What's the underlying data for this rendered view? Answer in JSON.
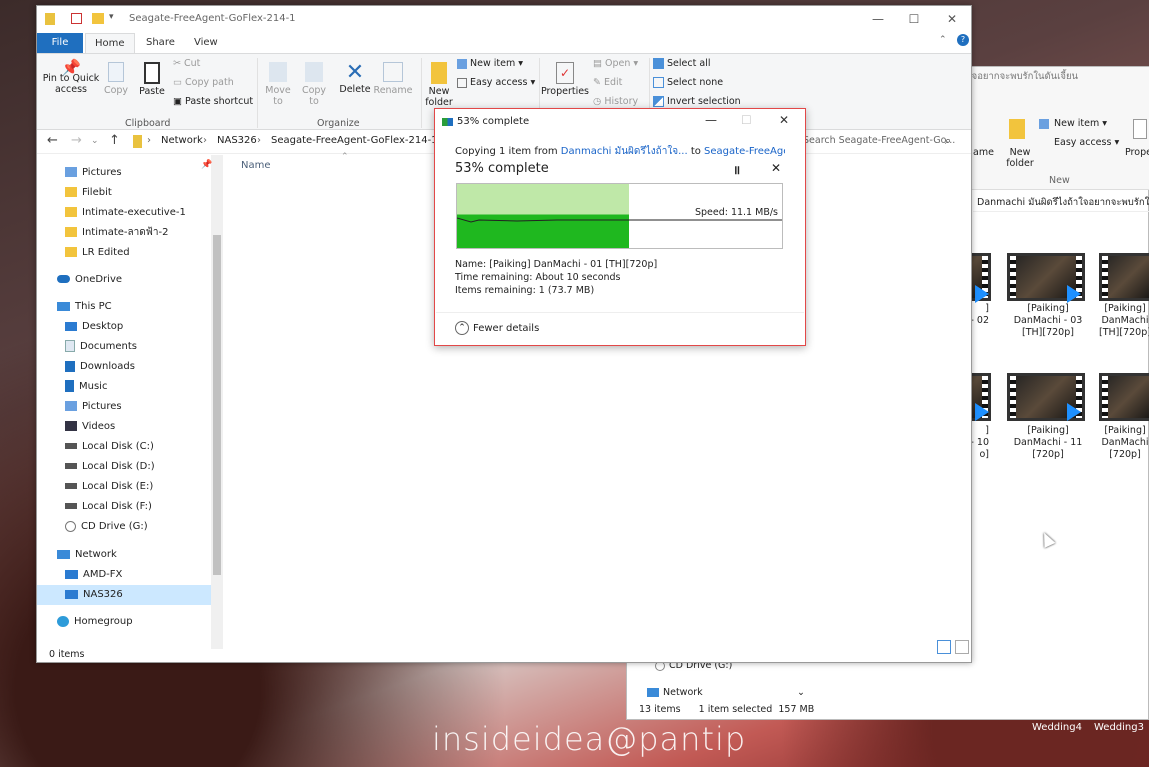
{
  "bg_explorer": {
    "ribbon": {
      "home_label": "ame",
      "new_item": "New item",
      "easy_access": "Easy access",
      "new_folder": "New folder",
      "group_new": "New",
      "properties": "Proper"
    },
    "path_text": "Danmachi มันผิดรึไงถ้าใจอยากจะพบรักในดันเจี้ยน",
    "top_text": "ใจอยากจะพบรักในดันเจี้ยน",
    "thumbs": [
      {
        "label": "]",
        "sub": "- 02"
      },
      {
        "label": "[Paiking] DanMachi - 03 [TH][720p]"
      },
      {
        "label": "[Paiking] DanMachi [TH][720p]"
      },
      {
        "label": "]",
        "sub": "- 10",
        "sub2": "o]"
      },
      {
        "label": "[Paiking] DanMachi - 11 [720p]"
      },
      {
        "label": "[Paiking] DanMachi [720p]"
      }
    ],
    "nav_cd": "CD Drive (G:)",
    "nav_network": "Network",
    "status_items": "13 items",
    "status_selected": "1 item selected",
    "status_size": "157 MB"
  },
  "window": {
    "title": "Seagate-FreeAgent-GoFlex-214-1",
    "tabs": [
      "File",
      "Home",
      "Share",
      "View"
    ],
    "ribbon": {
      "pin": "Pin to Quick access",
      "copy": "Copy",
      "paste": "Paste",
      "cut": "Cut",
      "copy_path": "Copy path",
      "paste_shortcut": "Paste shortcut",
      "clipboard": "Clipboard",
      "move_to": "Move to",
      "copy_to": "Copy to",
      "delete": "Delete",
      "rename": "Rename",
      "organize": "Organize",
      "new_item": "New item",
      "easy_access": "Easy access",
      "new_folder": "New folder",
      "properties": "Properties",
      "open": "Open",
      "edit": "Edit",
      "history": "History",
      "select_all": "Select all",
      "select_none": "Select none",
      "invert_selection": "Invert selection"
    },
    "address": {
      "crumbs": [
        "Network",
        "NAS326",
        "Seagate-FreeAgent-GoFlex-214-1"
      ],
      "search_placeholder": "Search Seagate-FreeAgent-Go..."
    },
    "nav": [
      {
        "label": "Pictures",
        "icon": "pictures-icon"
      },
      {
        "label": "Filebit",
        "icon": "folder-icon"
      },
      {
        "label": "Intimate-executive-1",
        "icon": "folder-icon"
      },
      {
        "label": "Intimate-ลาดฟ้า-2",
        "icon": "folder-icon"
      },
      {
        "label": "LR Edited",
        "icon": "folder-icon"
      },
      {
        "label": "OneDrive",
        "icon": "onedrive-icon"
      },
      {
        "label": "This PC",
        "icon": "pc-icon"
      },
      {
        "label": "Desktop",
        "icon": "desktop-icon"
      },
      {
        "label": "Documents",
        "icon": "documents-icon"
      },
      {
        "label": "Downloads",
        "icon": "downloads-icon"
      },
      {
        "label": "Music",
        "icon": "music-icon"
      },
      {
        "label": "Pictures",
        "icon": "pictures-icon"
      },
      {
        "label": "Videos",
        "icon": "videos-icon"
      },
      {
        "label": "Local Disk (C:)",
        "icon": "disk-icon"
      },
      {
        "label": "Local Disk (D:)",
        "icon": "disk-icon"
      },
      {
        "label": "Local Disk (E:)",
        "icon": "disk-icon"
      },
      {
        "label": "Local Disk (F:)",
        "icon": "disk-icon"
      },
      {
        "label": "CD Drive (G:)",
        "icon": "cd-icon"
      },
      {
        "label": "Network",
        "icon": "network-icon"
      },
      {
        "label": "AMD-FX",
        "icon": "computer-icon"
      },
      {
        "label": "NAS326",
        "icon": "computer-icon"
      },
      {
        "label": "Homegroup",
        "icon": "homegroup-icon"
      }
    ],
    "column_name": "Name",
    "status": "0 items"
  },
  "copy_dialog": {
    "title": "53% complete",
    "copying_prefix": "Copying 1 item from",
    "source": "Danmachi มันผิดรึไงถ้าใจ...",
    "to_word": "to",
    "destination": "Seagate-FreeAgent-Go...",
    "percent_text": "53% complete",
    "percent": 53,
    "speed": "Speed: 11.1 MB/s",
    "name": "Name: [Paiking] DanMachi - 01 [TH][720p]",
    "time_remaining": "Time remaining: About 10 seconds",
    "items_remaining": "Items remaining: 1 (73.7 MB)",
    "fewer_details": "Fewer details"
  },
  "taskbar": {
    "items": [
      "Wedding4",
      "Wedding3"
    ]
  },
  "watermark": "insideidea@pantip"
}
